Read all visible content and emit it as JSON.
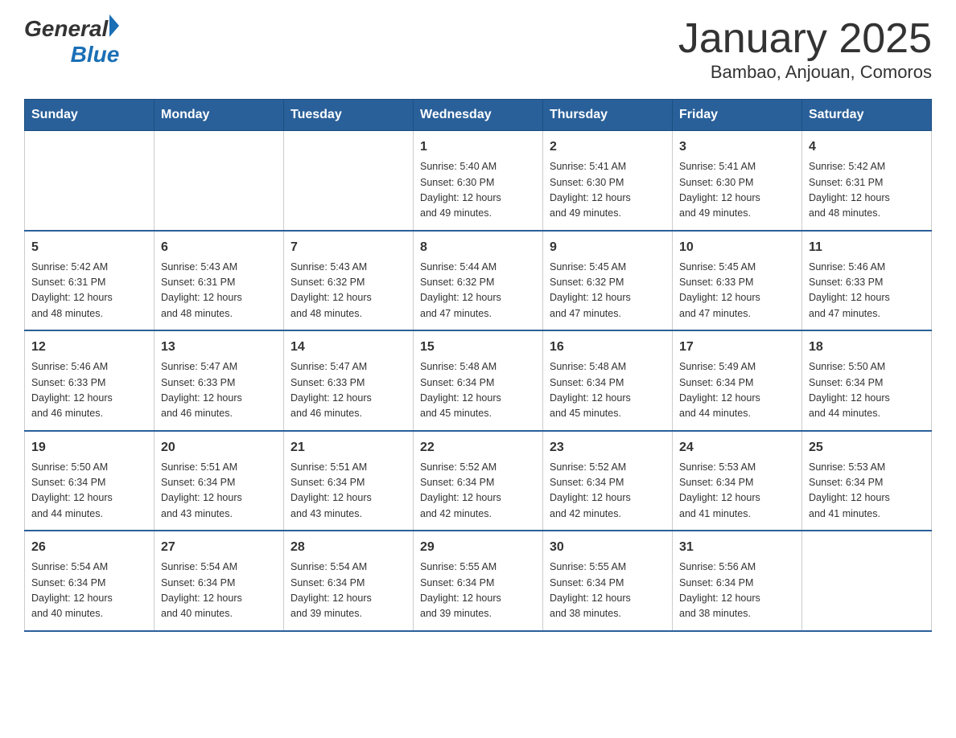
{
  "logo": {
    "general": "General",
    "blue": "Blue"
  },
  "header": {
    "title": "January 2025",
    "subtitle": "Bambao, Anjouan, Comoros"
  },
  "days_of_week": [
    "Sunday",
    "Monday",
    "Tuesday",
    "Wednesday",
    "Thursday",
    "Friday",
    "Saturday"
  ],
  "weeks": [
    [
      {
        "day": "",
        "info": ""
      },
      {
        "day": "",
        "info": ""
      },
      {
        "day": "",
        "info": ""
      },
      {
        "day": "1",
        "info": "Sunrise: 5:40 AM\nSunset: 6:30 PM\nDaylight: 12 hours\nand 49 minutes."
      },
      {
        "day": "2",
        "info": "Sunrise: 5:41 AM\nSunset: 6:30 PM\nDaylight: 12 hours\nand 49 minutes."
      },
      {
        "day": "3",
        "info": "Sunrise: 5:41 AM\nSunset: 6:30 PM\nDaylight: 12 hours\nand 49 minutes."
      },
      {
        "day": "4",
        "info": "Sunrise: 5:42 AM\nSunset: 6:31 PM\nDaylight: 12 hours\nand 48 minutes."
      }
    ],
    [
      {
        "day": "5",
        "info": "Sunrise: 5:42 AM\nSunset: 6:31 PM\nDaylight: 12 hours\nand 48 minutes."
      },
      {
        "day": "6",
        "info": "Sunrise: 5:43 AM\nSunset: 6:31 PM\nDaylight: 12 hours\nand 48 minutes."
      },
      {
        "day": "7",
        "info": "Sunrise: 5:43 AM\nSunset: 6:32 PM\nDaylight: 12 hours\nand 48 minutes."
      },
      {
        "day": "8",
        "info": "Sunrise: 5:44 AM\nSunset: 6:32 PM\nDaylight: 12 hours\nand 47 minutes."
      },
      {
        "day": "9",
        "info": "Sunrise: 5:45 AM\nSunset: 6:32 PM\nDaylight: 12 hours\nand 47 minutes."
      },
      {
        "day": "10",
        "info": "Sunrise: 5:45 AM\nSunset: 6:33 PM\nDaylight: 12 hours\nand 47 minutes."
      },
      {
        "day": "11",
        "info": "Sunrise: 5:46 AM\nSunset: 6:33 PM\nDaylight: 12 hours\nand 47 minutes."
      }
    ],
    [
      {
        "day": "12",
        "info": "Sunrise: 5:46 AM\nSunset: 6:33 PM\nDaylight: 12 hours\nand 46 minutes."
      },
      {
        "day": "13",
        "info": "Sunrise: 5:47 AM\nSunset: 6:33 PM\nDaylight: 12 hours\nand 46 minutes."
      },
      {
        "day": "14",
        "info": "Sunrise: 5:47 AM\nSunset: 6:33 PM\nDaylight: 12 hours\nand 46 minutes."
      },
      {
        "day": "15",
        "info": "Sunrise: 5:48 AM\nSunset: 6:34 PM\nDaylight: 12 hours\nand 45 minutes."
      },
      {
        "day": "16",
        "info": "Sunrise: 5:48 AM\nSunset: 6:34 PM\nDaylight: 12 hours\nand 45 minutes."
      },
      {
        "day": "17",
        "info": "Sunrise: 5:49 AM\nSunset: 6:34 PM\nDaylight: 12 hours\nand 44 minutes."
      },
      {
        "day": "18",
        "info": "Sunrise: 5:50 AM\nSunset: 6:34 PM\nDaylight: 12 hours\nand 44 minutes."
      }
    ],
    [
      {
        "day": "19",
        "info": "Sunrise: 5:50 AM\nSunset: 6:34 PM\nDaylight: 12 hours\nand 44 minutes."
      },
      {
        "day": "20",
        "info": "Sunrise: 5:51 AM\nSunset: 6:34 PM\nDaylight: 12 hours\nand 43 minutes."
      },
      {
        "day": "21",
        "info": "Sunrise: 5:51 AM\nSunset: 6:34 PM\nDaylight: 12 hours\nand 43 minutes."
      },
      {
        "day": "22",
        "info": "Sunrise: 5:52 AM\nSunset: 6:34 PM\nDaylight: 12 hours\nand 42 minutes."
      },
      {
        "day": "23",
        "info": "Sunrise: 5:52 AM\nSunset: 6:34 PM\nDaylight: 12 hours\nand 42 minutes."
      },
      {
        "day": "24",
        "info": "Sunrise: 5:53 AM\nSunset: 6:34 PM\nDaylight: 12 hours\nand 41 minutes."
      },
      {
        "day": "25",
        "info": "Sunrise: 5:53 AM\nSunset: 6:34 PM\nDaylight: 12 hours\nand 41 minutes."
      }
    ],
    [
      {
        "day": "26",
        "info": "Sunrise: 5:54 AM\nSunset: 6:34 PM\nDaylight: 12 hours\nand 40 minutes."
      },
      {
        "day": "27",
        "info": "Sunrise: 5:54 AM\nSunset: 6:34 PM\nDaylight: 12 hours\nand 40 minutes."
      },
      {
        "day": "28",
        "info": "Sunrise: 5:54 AM\nSunset: 6:34 PM\nDaylight: 12 hours\nand 39 minutes."
      },
      {
        "day": "29",
        "info": "Sunrise: 5:55 AM\nSunset: 6:34 PM\nDaylight: 12 hours\nand 39 minutes."
      },
      {
        "day": "30",
        "info": "Sunrise: 5:55 AM\nSunset: 6:34 PM\nDaylight: 12 hours\nand 38 minutes."
      },
      {
        "day": "31",
        "info": "Sunrise: 5:56 AM\nSunset: 6:34 PM\nDaylight: 12 hours\nand 38 minutes."
      },
      {
        "day": "",
        "info": ""
      }
    ]
  ]
}
